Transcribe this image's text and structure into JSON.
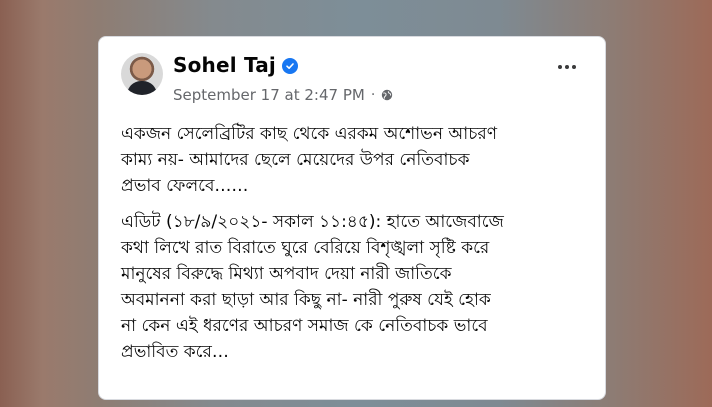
{
  "post": {
    "author": "Sohel Taj",
    "timestamp": "September 17 at 2:47 PM",
    "separator": "·",
    "privacy_icon": "globe-icon",
    "verified_icon": "verified-badge-icon",
    "more_icon": "more-options-icon",
    "paragraphs": [
      "একজন সেলেব্রিটির কাছ থেকে এরকম অশোভন আচরণ\nকাম্য নয়- আমাদের ছেলে মেয়েদের উপর নেতিবাচক\nপ্রভাব ফেলবে……",
      "এডিট (১৮/৯/২০২১- সকাল ১১:৪৫): হাতে আজেবাজে\nকথা লিখে রাত বিরাতে ঘুরে বেরিয়ে বিশৃঙ্খলা সৃষ্টি করে\nমানুষের বিরুদ্ধে মিথ্যা অপবাদ দেয়া নারী জাতিকে\nঅবমাননা করা ছাড়া আর কিছু না- নারী পুরুষ যেই হোক\nনা কেন এই ধরণের আচরণ সমাজ কে নেতিবাচক ভাবে\nপ্রভাবিত করে…"
    ]
  },
  "colors": {
    "verified": "#1877f2",
    "meta_text": "#65676b",
    "body_text": "#050505",
    "card_bg": "#ffffff"
  }
}
